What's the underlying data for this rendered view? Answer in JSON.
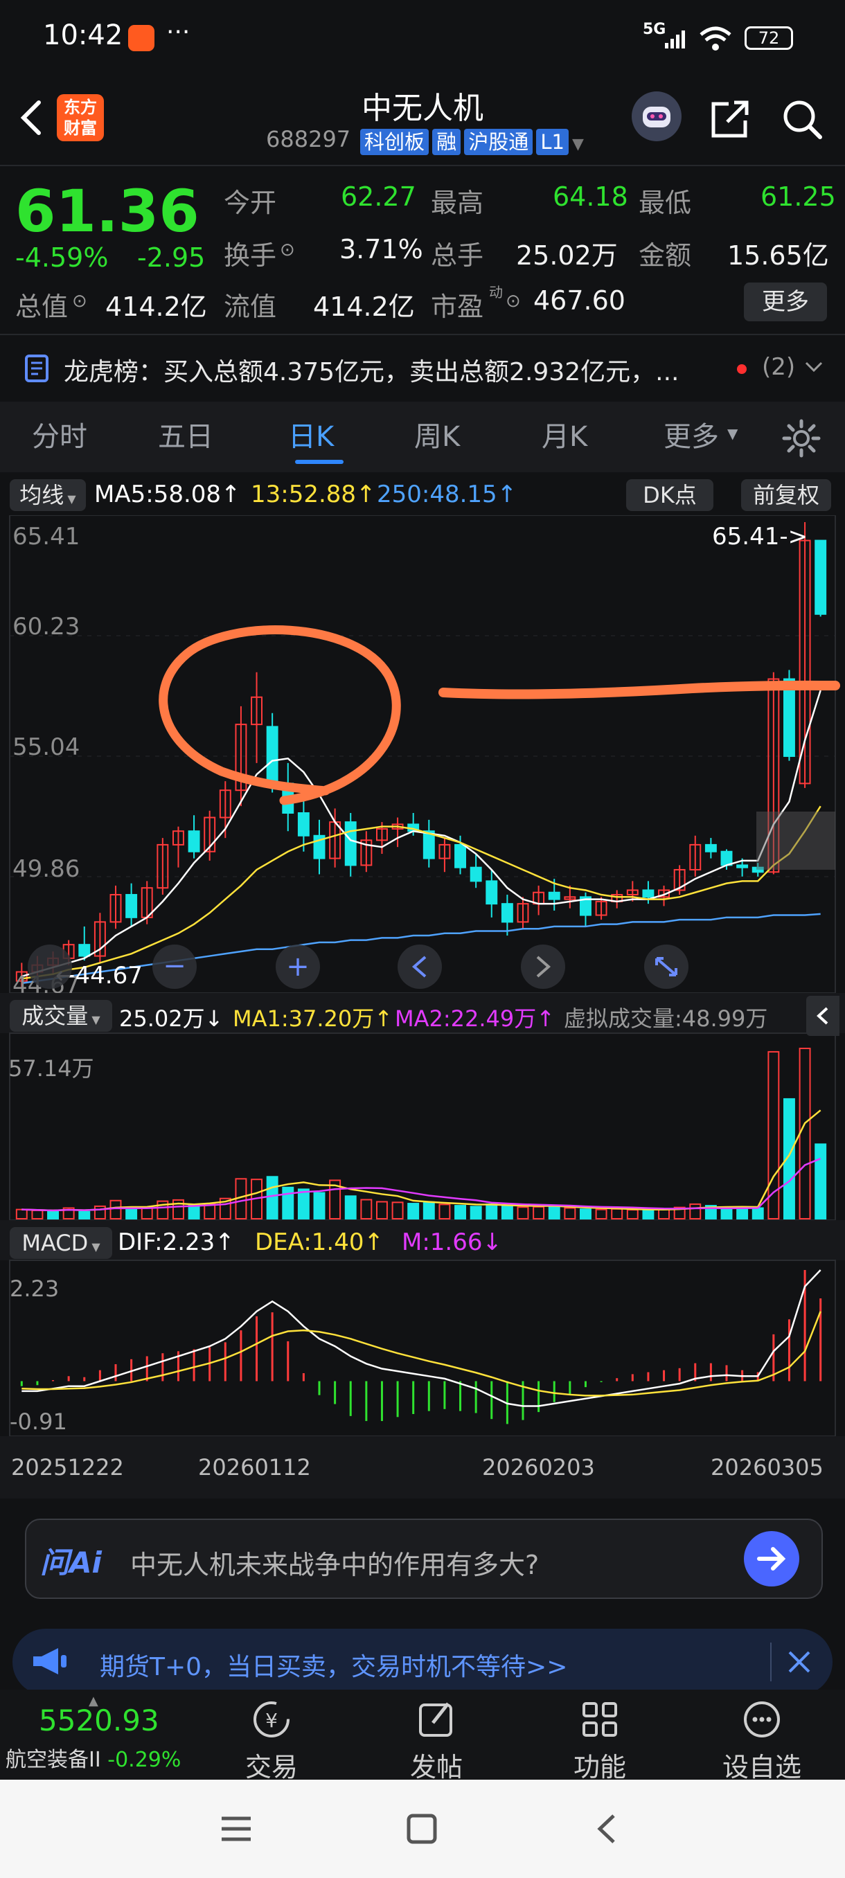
{
  "status": {
    "time": "10:42",
    "network": "5G",
    "battery": "72"
  },
  "header": {
    "logo_line1": "东方",
    "logo_line2": "财富",
    "stock_name": "中无人机",
    "stock_code": "688297",
    "tags": [
      "科创板",
      "融",
      "沪股通",
      "L1"
    ]
  },
  "quote": {
    "price": "61.36",
    "change_pct": "-4.59%",
    "change": "-2.95",
    "rows": [
      [
        {
          "label": "今开",
          "value": "62.27"
        },
        {
          "label": "最高",
          "value": "64.18"
        },
        {
          "label": "最低",
          "value": "61.25"
        }
      ],
      [
        {
          "label": "换手",
          "value": "3.71%"
        },
        {
          "label": "总手",
          "value": "25.02万"
        },
        {
          "label": "金额",
          "value": "15.65亿"
        }
      ],
      [
        {
          "label": "总值",
          "value": "414.2亿"
        },
        {
          "label": "流值",
          "value": "414.2亿"
        },
        {
          "label": "市盈",
          "value": "467.60"
        }
      ]
    ],
    "dong": "动",
    "more": "更多"
  },
  "news": {
    "text": "龙虎榜：买入总额4.375亿元，卖出总额2.932亿元，...",
    "count": "(2)"
  },
  "tabs": [
    "分时",
    "五日",
    "日K",
    "周K",
    "月K",
    "更多"
  ],
  "kline": {
    "ma_selector": "均线",
    "ma5": "MA5:58.08",
    "ma13": "13:52.88",
    "ma250": "250:48.15",
    "dk": "DK点",
    "fq": "前复权",
    "y_labels": [
      "65.41",
      "60.23",
      "55.04",
      "49.86",
      "44.67"
    ],
    "high_marker": "65.41->",
    "low_marker": "44.67"
  },
  "volume": {
    "selector": "成交量",
    "vol": "25.02万",
    "ma1": "MA1:37.20万",
    "ma2": "MA2:22.49万",
    "virtual": "虚拟成交量:48.99万",
    "y_label": "57.14万"
  },
  "macd": {
    "selector": "MACD",
    "dif": "DIF:2.23",
    "dea": "DEA:1.40",
    "m": "M:1.66",
    "y_top": "2.23",
    "y_bottom": "-0.91"
  },
  "dates": [
    "20251222",
    "20260112",
    "20260203",
    "20260305"
  ],
  "chart_data": {
    "type": "candlestick",
    "y_range": [
      44.67,
      65.41
    ],
    "ohlc": [
      [
        45.2,
        46.0,
        44.9,
        45.6
      ],
      [
        45.6,
        46.3,
        45.1,
        45.9
      ],
      [
        45.9,
        46.5,
        45.5,
        46.2
      ],
      [
        46.2,
        47.0,
        45.9,
        46.8
      ],
      [
        46.8,
        47.6,
        46.1,
        46.3
      ],
      [
        46.3,
        48.2,
        46.0,
        47.8
      ],
      [
        47.8,
        49.4,
        47.5,
        49.0
      ],
      [
        49.0,
        49.5,
        47.6,
        48.0
      ],
      [
        48.0,
        49.6,
        47.7,
        49.3
      ],
      [
        49.3,
        51.5,
        49.0,
        51.2
      ],
      [
        51.2,
        52.0,
        50.2,
        51.8
      ],
      [
        51.8,
        52.5,
        50.6,
        50.9
      ],
      [
        50.9,
        52.7,
        50.5,
        52.4
      ],
      [
        52.4,
        54.0,
        51.5,
        53.6
      ],
      [
        53.6,
        57.3,
        52.9,
        56.5
      ],
      [
        56.5,
        58.8,
        54.8,
        57.7
      ],
      [
        56.4,
        57.0,
        53.5,
        53.9
      ],
      [
        53.9,
        54.8,
        51.8,
        52.6
      ],
      [
        52.6,
        53.2,
        50.9,
        51.6
      ],
      [
        51.6,
        52.3,
        49.9,
        50.6
      ],
      [
        50.6,
        52.8,
        50.2,
        52.2
      ],
      [
        52.2,
        52.6,
        49.8,
        50.3
      ],
      [
        50.3,
        51.8,
        50.0,
        51.4
      ],
      [
        51.4,
        52.2,
        50.8,
        51.9
      ],
      [
        51.9,
        52.4,
        51.1,
        52.1
      ],
      [
        52.1,
        52.6,
        51.6,
        51.8
      ],
      [
        51.8,
        52.3,
        50.2,
        50.6
      ],
      [
        50.6,
        51.5,
        50.0,
        51.2
      ],
      [
        51.2,
        51.6,
        49.9,
        50.2
      ],
      [
        50.2,
        50.8,
        49.3,
        49.6
      ],
      [
        49.6,
        50.1,
        48.0,
        48.6
      ],
      [
        48.6,
        49.0,
        47.2,
        47.8
      ],
      [
        47.8,
        48.9,
        47.5,
        48.6
      ],
      [
        48.6,
        49.4,
        48.1,
        49.1
      ],
      [
        49.1,
        49.7,
        48.3,
        48.8
      ],
      [
        48.8,
        49.4,
        48.4,
        48.9
      ],
      [
        48.9,
        49.1,
        47.6,
        48.1
      ],
      [
        48.1,
        48.9,
        47.9,
        48.7
      ],
      [
        48.7,
        49.2,
        48.4,
        49.0
      ],
      [
        49.0,
        49.6,
        48.7,
        49.2
      ],
      [
        49.2,
        49.6,
        48.6,
        48.9
      ],
      [
        48.9,
        49.4,
        48.5,
        49.2
      ],
      [
        49.2,
        50.3,
        49.0,
        50.1
      ],
      [
        50.1,
        51.6,
        49.8,
        51.2
      ],
      [
        51.2,
        51.5,
        50.6,
        50.9
      ],
      [
        50.9,
        51.0,
        50.1,
        50.3
      ],
      [
        50.3,
        50.6,
        49.8,
        50.2
      ],
      [
        50.2,
        50.4,
        49.8,
        50.0
      ],
      [
        50.0,
        58.8,
        49.9,
        58.5
      ],
      [
        58.5,
        58.9,
        54.9,
        55.1
      ],
      [
        53.9,
        65.41,
        53.7,
        64.6
      ],
      [
        64.6,
        64.18,
        61.25,
        61.36
      ]
    ],
    "ma5_series": [
      45.4,
      45.6,
      45.8,
      46.0,
      46.2,
      46.6,
      47.2,
      47.6,
      48.0,
      48.7,
      49.5,
      50.4,
      51.1,
      51.9,
      53.1,
      54.3,
      54.9,
      55.0,
      54.4,
      53.4,
      52.2,
      51.4,
      51.2,
      51.1,
      51.5,
      51.8,
      51.7,
      51.6,
      51.3,
      50.8,
      50.1,
      49.3,
      48.8,
      48.6,
      48.6,
      48.7,
      48.8,
      48.8,
      48.7,
      48.8,
      48.8,
      49.0,
      49.3,
      49.7,
      50.0,
      50.3,
      50.5,
      50.5,
      52.1,
      53.1,
      55.8,
      58.0
    ],
    "ma13_series": [
      45.3,
      45.4,
      45.5,
      45.7,
      45.8,
      46.0,
      46.2,
      46.4,
      46.7,
      47.0,
      47.3,
      47.7,
      48.2,
      48.8,
      49.4,
      50.1,
      50.5,
      50.9,
      51.2,
      51.4,
      51.6,
      51.8,
      51.9,
      52.0,
      52.0,
      51.9,
      51.7,
      51.5,
      51.3,
      51.0,
      50.7,
      50.4,
      50.1,
      49.8,
      49.5,
      49.3,
      49.2,
      49.0,
      48.9,
      48.9,
      48.8,
      48.8,
      48.9,
      49.1,
      49.3,
      49.5,
      49.6,
      49.6,
      50.3,
      50.8,
      51.8,
      52.9
    ],
    "ma250_series": [
      45.1,
      45.2,
      45.3,
      45.4,
      45.5,
      45.6,
      45.7,
      45.8,
      45.9,
      46.0,
      46.1,
      46.2,
      46.3,
      46.4,
      46.5,
      46.6,
      46.6,
      46.7,
      46.8,
      46.9,
      46.9,
      47.0,
      47.0,
      47.1,
      47.1,
      47.2,
      47.2,
      47.3,
      47.3,
      47.4,
      47.4,
      47.4,
      47.5,
      47.5,
      47.6,
      47.6,
      47.6,
      47.7,
      47.7,
      47.8,
      47.8,
      47.8,
      47.9,
      47.9,
      47.9,
      48.0,
      48.0,
      48.0,
      48.1,
      48.1,
      48.1,
      48.15
    ],
    "volume": [
      3.1,
      2.8,
      2.5,
      3.6,
      2.4,
      4.2,
      6.1,
      3.4,
      3.8,
      5.9,
      6.3,
      4.7,
      5.1,
      6.8,
      13.4,
      13.2,
      14.1,
      10.5,
      9.9,
      8.7,
      12.9,
      7.6,
      6.4,
      5.7,
      5.5,
      5.1,
      5.6,
      4.8,
      4.4,
      4.1,
      4.9,
      4.6,
      3.9,
      4.0,
      4.1,
      3.6,
      3.2,
      3.1,
      3.3,
      3.0,
      2.9,
      3.1,
      3.8,
      4.9,
      4.4,
      3.5,
      3.4,
      3.6,
      56.0,
      40.2,
      57.14,
      25.02
    ],
    "volume_up": [
      1,
      1,
      0,
      1,
      0,
      1,
      1,
      0,
      1,
      1,
      1,
      0,
      1,
      1,
      1,
      1,
      0,
      0,
      0,
      0,
      1,
      0,
      1,
      1,
      1,
      0,
      0,
      1,
      0,
      0,
      0,
      0,
      1,
      1,
      0,
      1,
      0,
      1,
      1,
      1,
      0,
      1,
      1,
      1,
      0,
      0,
      0,
      0,
      1,
      0,
      1,
      0
    ],
    "macd_dif": [
      -0.2,
      -0.2,
      -0.15,
      -0.1,
      -0.1,
      0.0,
      0.1,
      0.2,
      0.3,
      0.4,
      0.5,
      0.6,
      0.7,
      0.85,
      1.1,
      1.4,
      1.6,
      1.4,
      1.1,
      0.85,
      0.7,
      0.5,
      0.35,
      0.25,
      0.2,
      0.15,
      0.1,
      0.05,
      -0.05,
      -0.15,
      -0.3,
      -0.45,
      -0.5,
      -0.5,
      -0.45,
      -0.4,
      -0.35,
      -0.3,
      -0.25,
      -0.2,
      -0.15,
      -0.1,
      -0.05,
      0.05,
      0.1,
      0.12,
      0.1,
      0.1,
      0.6,
      0.9,
      1.9,
      2.23
    ],
    "macd_dea": [
      -0.15,
      -0.16,
      -0.16,
      -0.15,
      -0.14,
      -0.11,
      -0.07,
      -0.02,
      0.05,
      0.12,
      0.2,
      0.28,
      0.36,
      0.46,
      0.59,
      0.75,
      0.91,
      1.0,
      1.02,
      0.99,
      0.93,
      0.85,
      0.75,
      0.65,
      0.56,
      0.48,
      0.4,
      0.33,
      0.25,
      0.17,
      0.08,
      -0.02,
      -0.11,
      -0.19,
      -0.24,
      -0.27,
      -0.29,
      -0.29,
      -0.28,
      -0.27,
      -0.24,
      -0.21,
      -0.18,
      -0.13,
      -0.08,
      -0.04,
      -0.01,
      0.01,
      0.13,
      0.28,
      0.6,
      1.4
    ]
  },
  "ask": {
    "placeholder": "中无人机未来战争中的作用有多大?",
    "brand": "问Ai"
  },
  "banner": {
    "text": "期货T+0，当日买卖，交易时机不等待>>"
  },
  "bottom": {
    "index_value": "5520.93",
    "index_name": "航空装备II",
    "index_change": "-0.29%",
    "items": [
      "交易",
      "发帖",
      "功能",
      "设自选"
    ]
  },
  "colors": {
    "up": "#ff3b3b",
    "down": "#18e6e6",
    "ma5": "#ffffff",
    "ma13": "#ffe23b",
    "ma250": "#4fa3ff",
    "annotation": "#ff7a45"
  }
}
